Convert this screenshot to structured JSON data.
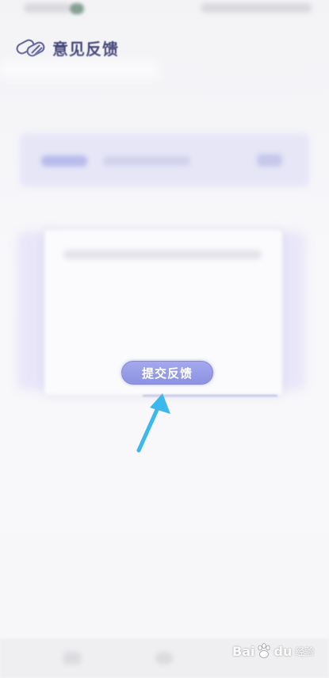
{
  "header": {
    "title": "意见反馈",
    "logo_icon": "feedback-logo-icon"
  },
  "submit": {
    "label": "提交反馈"
  },
  "watermark": {
    "brand_left": "Bai",
    "brand_right": "du",
    "suffix": "经验"
  },
  "colors": {
    "accent": "#8d92e2",
    "title": "#45467a",
    "pointer_arrow": "#3db8ef"
  }
}
